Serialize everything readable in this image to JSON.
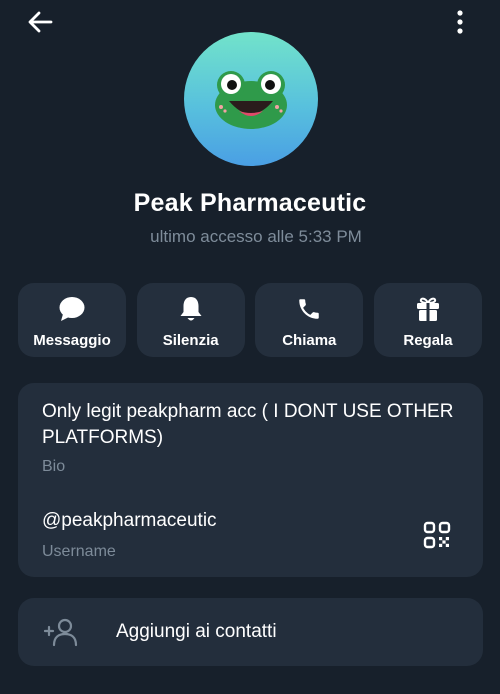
{
  "header": {
    "back_icon": "arrow-left-icon",
    "menu_icon": "more-vertical-icon"
  },
  "profile": {
    "avatar_icon": "frog-emoji-avatar",
    "name": "Peak Pharmaceutic",
    "last_seen": "ultimo accesso alle 5:33 PM"
  },
  "actions": [
    {
      "label": "Messaggio",
      "icon": "message-icon"
    },
    {
      "label": "Silenzia",
      "icon": "bell-icon"
    },
    {
      "label": "Chiama",
      "icon": "phone-icon"
    },
    {
      "label": "Regala",
      "icon": "gift-icon"
    }
  ],
  "info": {
    "bio": "Only legit peakpharm acc ( I DONT USE OTHER PLATFORMS)",
    "bio_label": "Bio",
    "username": "@peakpharmaceutic",
    "username_label": "Username",
    "qr_icon": "qr-code-icon"
  },
  "add_contact": {
    "label": "Aggiungi ai contatti",
    "icon": "add-user-icon"
  },
  "colors": {
    "background": "#17202b",
    "card": "#232e3c",
    "secondary_text": "#7d8b99"
  }
}
